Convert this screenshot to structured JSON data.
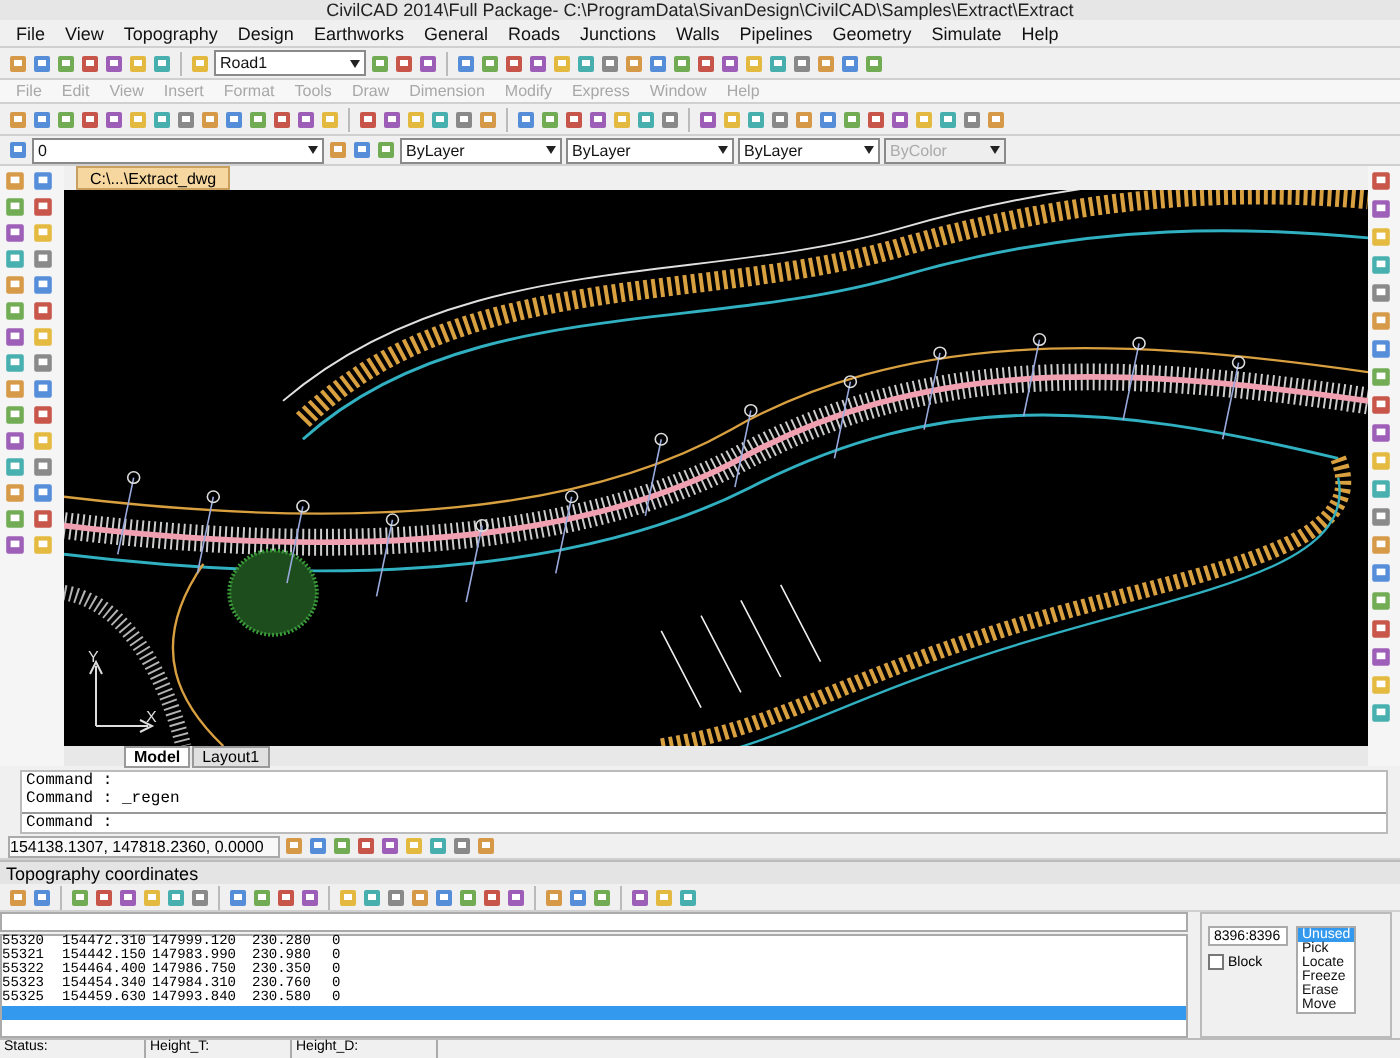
{
  "window": {
    "title": "CivilCAD 2014\\Full Package- C:\\ProgramData\\SivanDesign\\CivilCAD\\Samples\\Extract\\Extract"
  },
  "menu": [
    {
      "label": "File"
    },
    {
      "label": "View"
    },
    {
      "label": "Topography"
    },
    {
      "label": "Design"
    },
    {
      "label": "Earthworks"
    },
    {
      "label": "General"
    },
    {
      "label": "Roads"
    },
    {
      "label": "Junctions"
    },
    {
      "label": "Walls"
    },
    {
      "label": "Pipelines"
    },
    {
      "label": "Geometry"
    },
    {
      "label": "Simulate"
    },
    {
      "label": "Help"
    }
  ],
  "road_selector": {
    "value": "Road1"
  },
  "cad_menu": [
    {
      "label": "File",
      "disabled": true
    },
    {
      "label": "Edit",
      "disabled": true
    },
    {
      "label": "View",
      "disabled": true
    },
    {
      "label": "Insert",
      "disabled": true
    },
    {
      "label": "Format",
      "disabled": true
    },
    {
      "label": "Tools",
      "disabled": true
    },
    {
      "label": "Draw",
      "disabled": true
    },
    {
      "label": "Dimension",
      "disabled": true
    },
    {
      "label": "Modify",
      "disabled": true
    },
    {
      "label": "Express",
      "disabled": true
    },
    {
      "label": "Window",
      "disabled": true
    },
    {
      "label": "Help",
      "disabled": true
    }
  ],
  "properties": [
    {
      "kind": "layer",
      "value": "0",
      "disabled": false
    },
    {
      "kind": "color",
      "value": "ByLayer",
      "disabled": false
    },
    {
      "kind": "linetype",
      "value": "ByLayer",
      "disabled": false
    },
    {
      "kind": "lineweight",
      "value": "ByLayer",
      "disabled": false
    },
    {
      "kind": "plot",
      "value": "ByColor",
      "disabled": true
    }
  ],
  "document_tab": {
    "label": "C:\\...\\Extract_dwg"
  },
  "ucs_icon": {
    "x_label": "X",
    "y_label": "Y"
  },
  "layout_tabs": [
    {
      "label": "Model",
      "selected": true
    },
    {
      "label": "Layout1",
      "selected": false
    }
  ],
  "command_lines": [
    "Command :",
    "Command : _regen"
  ],
  "command_prompt": "Command :",
  "coordinates": "154138.1307, 147818.2360, 0.0000",
  "panel": {
    "title": "Topography coordinates",
    "rows": [
      {
        "cells": [
          "55320",
          "154472.310",
          "147999.120",
          "230.280",
          "0"
        ],
        "selected": false
      },
      {
        "cells": [
          "55321",
          "154442.150",
          "147983.990",
          "230.980",
          "0"
        ],
        "selected": false
      },
      {
        "cells": [
          "55322",
          "154464.400",
          "147986.750",
          "230.350",
          "0"
        ],
        "selected": false
      },
      {
        "cells": [
          "55323",
          "154454.340",
          "147984.310",
          "230.760",
          "0"
        ],
        "selected": false
      },
      {
        "cells": [
          "55325",
          "154459.630",
          "147993.840",
          "230.580",
          "0"
        ],
        "selected": false
      },
      {
        "selected": true
      }
    ],
    "range": "8396:8396",
    "block": {
      "label": "Block",
      "checked": false
    },
    "modes": [
      {
        "label": "Unused",
        "selected": true
      },
      {
        "label": "Pick",
        "selected": false
      },
      {
        "label": "Locate",
        "selected": false
      },
      {
        "label": "Freeze",
        "selected": false
      },
      {
        "label": "Erase",
        "selected": false
      },
      {
        "label": "Move",
        "selected": false
      }
    ]
  },
  "status_fields": [
    "Status:",
    "Height_T:",
    "Height_D:"
  ]
}
